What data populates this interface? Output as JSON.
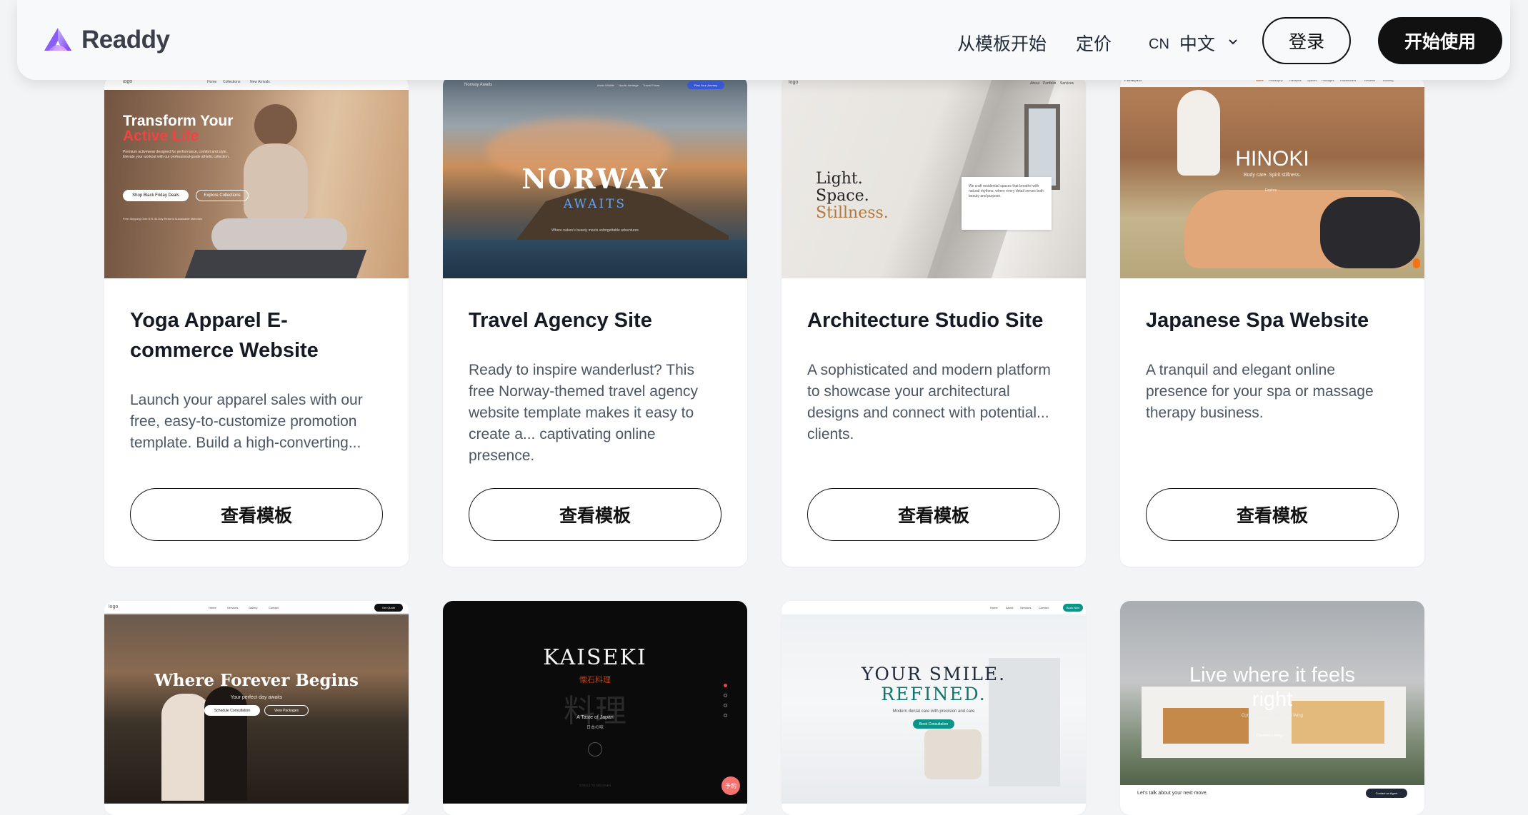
{
  "nav": {
    "brand": "Readdy",
    "links": [
      "从模板开始",
      "定价"
    ],
    "lang_code": "CN",
    "lang_label": "中文",
    "login": "登录",
    "start": "开始使用",
    "accent": "#8b5cf6"
  },
  "view_label": "查看模板",
  "cards": [
    {
      "title": "Yoga Apparel E-commerce Website",
      "desc": "Launch your apparel sales with our free, easy-to-customize promotion template. Build a high-converting...",
      "thumb": {
        "logo": "logo",
        "nav": [
          "Home",
          "Collections",
          "New Arrivals"
        ],
        "headline1": "Transform Your",
        "headline2": "Active Life",
        "body": "Premium activewear designed for performance, comfort and style. Elevate your workout with our professional-grade athletic collection.",
        "btn1": "Shop Black Friday Deals",
        "btn2": "Explore Collections",
        "footnote": "Free Shipping Over $75   30-Day Returns   Sustainable Materials"
      }
    },
    {
      "title": "Travel Agency Site",
      "desc": "Ready to inspire wanderlust? This free Norway-themed travel agency website template makes it easy to create a... captivating online presence.",
      "thumb": {
        "brand": "Norway Awaits",
        "nav": [
          "Arctic Wildlife",
          "Nordic Heritage",
          "Travel Extras"
        ],
        "cta": "Plan Your Journey",
        "headline1": "NORWAY",
        "headline2": "AWAITS",
        "sub": "Where nature's beauty meets unforgettable adventures"
      }
    },
    {
      "title": "Architecture Studio Site",
      "desc": "A sophisticated and modern platform to showcase your architectural designs and connect with potential... clients.",
      "thumb": {
        "logo": "logo",
        "nav": [
          "About",
          "Portfolio",
          "Services"
        ],
        "line1": "Light.",
        "line2": "Space.",
        "line3": "Stillness.",
        "note": "We craft residential spaces that breathe with natural rhythms, where every detail serves both beauty and purpose."
      }
    },
    {
      "title": "Japanese Spa Website",
      "desc": "A tranquil and elegant online presence for your spa or massage therapy business.",
      "thumb": {
        "logo": "HINOKI",
        "nav": [
          "Home",
          "Philosophy",
          "Therapies",
          "Spaces",
          "Packages",
          "Practitioners",
          "Reviews",
          "Booking"
        ],
        "headline": "HINOKI",
        "sub": "Body care. Spirit stillness.",
        "cta": "Explore ↓"
      }
    },
    {
      "title": "",
      "desc": "",
      "thumb": {
        "logo": "logo",
        "nav": [
          "Home",
          "Services",
          "Gallery",
          "Contact"
        ],
        "cta": "Get Quote",
        "headline": "Where Forever Begins",
        "sub": "Your perfect day awaits",
        "btn1": "Schedule Consultation",
        "btn2": "View Packages"
      }
    },
    {
      "title": "",
      "desc": "",
      "thumb": {
        "headline": "KAISEKI",
        "jp1": "懐石料理",
        "jp2": "料理",
        "sub": "A Taste of Japan",
        "jp3": "日本の味",
        "footer": "SCROLL TO DISCOVER",
        "badge": "予約"
      }
    },
    {
      "title": "",
      "desc": "",
      "thumb": {
        "nav": [
          "Home",
          "About",
          "Services",
          "Contact"
        ],
        "cta": "Book Now",
        "headline1": "YOUR SMILE.",
        "headline2": "REFINED.",
        "sub": "Modern dental care with precision and care",
        "btn": "Book Consultation"
      }
    },
    {
      "title": "",
      "desc": "",
      "thumb": {
        "headline1": "Live where it feels",
        "headline2": "right",
        "sub": "Curated homes, thoughtful living",
        "cta": "Discover Listings →",
        "footer": "Let's talk about your next move.",
        "footer_btn": "Contact an Agent"
      }
    }
  ]
}
